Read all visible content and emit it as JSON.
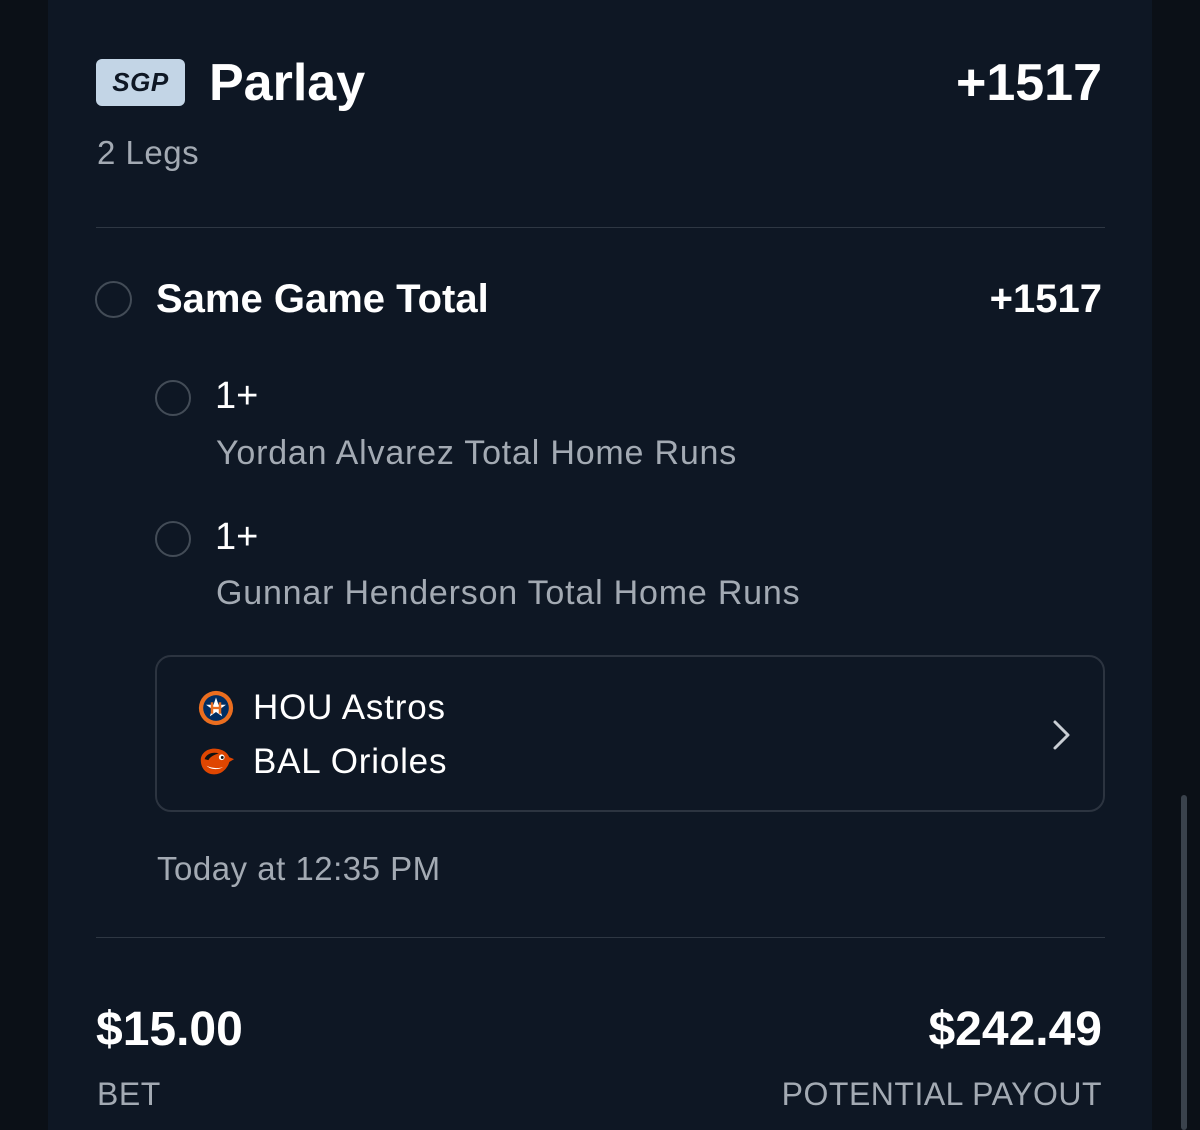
{
  "parlay": {
    "badge": "SGP",
    "title": "Parlay",
    "odds": "+1517",
    "legs_count": "2 Legs"
  },
  "same_game": {
    "title": "Same Game Total",
    "odds": "+1517",
    "legs": [
      {
        "line": "1+",
        "description": "Yordan Alvarez Total Home Runs"
      },
      {
        "line": "1+",
        "description": "Gunnar Henderson Total Home Runs"
      }
    ]
  },
  "game": {
    "teams": [
      {
        "name": "HOU Astros",
        "icon": "astros-logo-icon",
        "color": "#eb6e1f"
      },
      {
        "name": "BAL Orioles",
        "icon": "orioles-logo-icon",
        "color": "#df4601"
      }
    ],
    "time": "Today at 12:35 PM"
  },
  "summary": {
    "bet_amount": "$15.00",
    "bet_label": "BET",
    "payout_amount": "$242.49",
    "payout_label": "POTENTIAL PAYOUT"
  },
  "colors": {
    "background": "#0e1724",
    "badge": "#c3d5e6",
    "muted_text": "#a3aab3",
    "primary_text": "#ffffff"
  }
}
